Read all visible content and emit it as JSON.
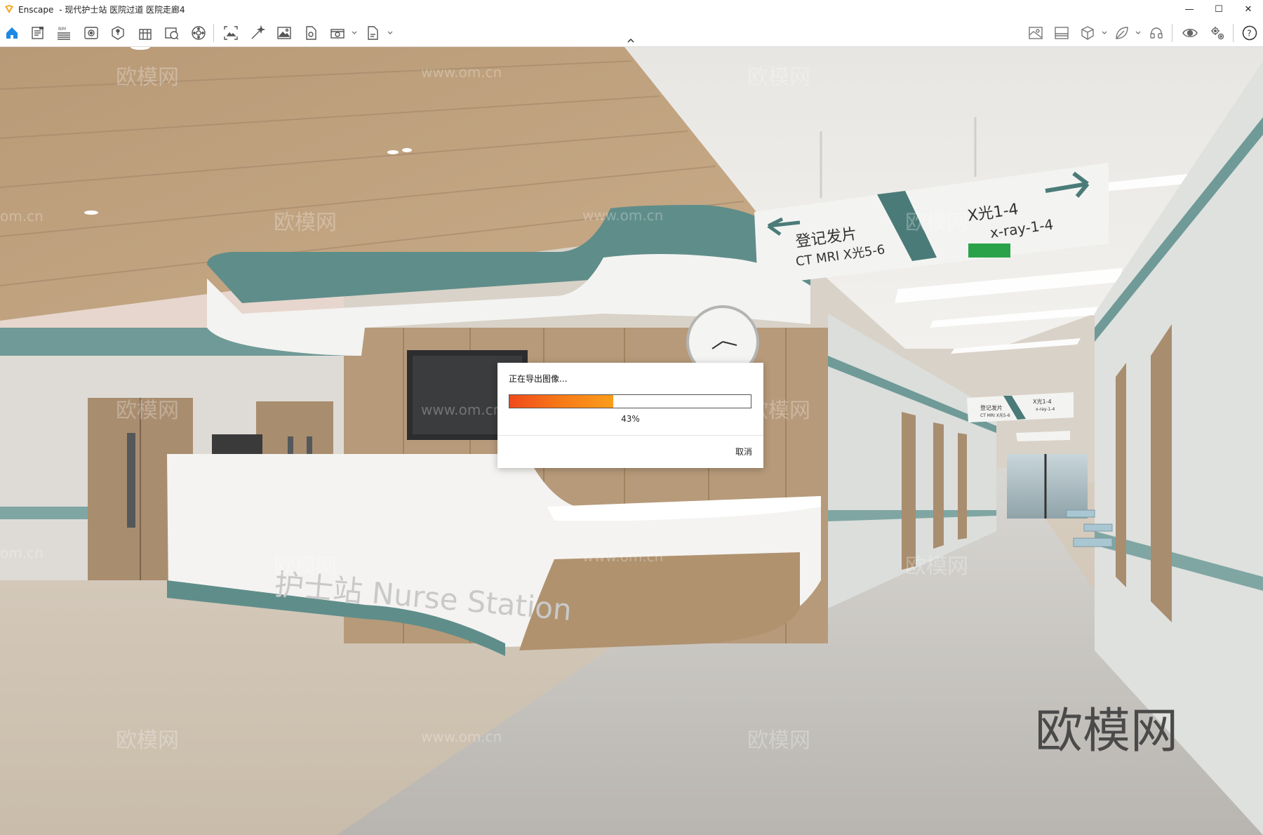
{
  "window": {
    "app_name": "Enscape",
    "title_separator": "-",
    "document_title": "现代护士站 医院过道 医院走廊4",
    "controls": {
      "minimize": "—",
      "maximize": "☐",
      "close": "✕"
    }
  },
  "toolbar": {
    "left_icons": [
      "home-icon",
      "document-icon",
      "bim-icon",
      "visual-settings-icon",
      "asset-library-icon",
      "building-icon",
      "scene-info-icon",
      "panorama-icon",
      "screenshot-icon",
      "magic-edit-icon",
      "image-export-icon",
      "export-icon",
      "batch-render-icon",
      "file-export-icon"
    ],
    "bim_label": "BIM",
    "right_icons": [
      "map-icon",
      "landscape-icon",
      "cube-icon",
      "leaf-icon",
      "headset-icon",
      "eye-icon",
      "settings-icon",
      "help-icon"
    ],
    "accent_color": "#1e88e5"
  },
  "scene": {
    "signs": {
      "big_left_line1": "登记发片",
      "big_left_line2": "CT MRI X光5-6",
      "big_right_line1": "X光1-4",
      "big_right_line2": "x-ray-1-4",
      "small_left": "登记发片",
      "small_left_sub": "CT MRI X光5-6",
      "small_right": "X光1-4",
      "small_right_sub": "x-ray-1-4"
    },
    "desk_text": "护士站 Nurse Station",
    "watermark_text": "欧模网",
    "watermark_url": "www.om.cn",
    "watermark_url_partial": "om.cn"
  },
  "dialog": {
    "title": "正在导出图像...",
    "progress": 43,
    "progress_label": "43%",
    "cancel_label": "取消"
  }
}
